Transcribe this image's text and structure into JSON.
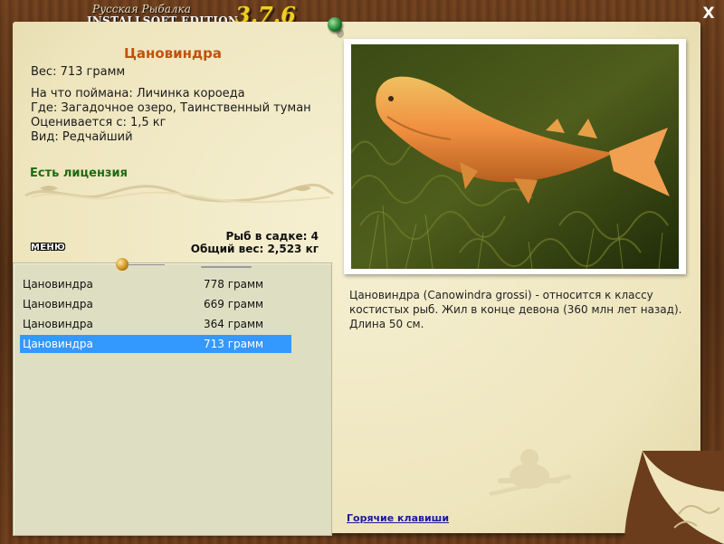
{
  "title": {
    "small": "Русская Рыбалка",
    "edition": "INSTALLSOFT EDITION",
    "version": "3.7.6"
  },
  "close_label": "X",
  "fish": {
    "name": "Цановиндра",
    "weight": "Вес: 713 грамм",
    "bait": "На что поймана: Личинка короеда",
    "location": "Где: Загадочное озеро, Таинственный туман",
    "valued_from": "Оценивается с: 1,5 кг",
    "rarity": "Вид: Редчайший",
    "license": "Есть лицензия"
  },
  "keepnet": {
    "count_label": "Рыб в садке: 4",
    "weight_label": "Общий вес: 2,523 кг"
  },
  "menu_label": "МЕНЮ",
  "catch_list": [
    {
      "name": "Цановиндра",
      "weight": "778 грамм"
    },
    {
      "name": "Цановиндра",
      "weight": "669 грамм"
    },
    {
      "name": "Цановиндра",
      "weight": "364 грамм"
    },
    {
      "name": "Цановиндра",
      "weight": "713 грамм"
    }
  ],
  "selected_row": 4,
  "description": "Цановиндра (Canowindra grossi) - относится к классу костистых рыб. Жил в конце девона (360 млн лет назад). Длина 50 см.",
  "hotkeys_label": "Горячие клавиши",
  "colors": {
    "paper": "#f2ebc6",
    "fish_name": "#c0520c",
    "license": "#1e6b14",
    "selection": "#3399ff",
    "link": "#1a1aa0",
    "version": "#f0d020"
  }
}
